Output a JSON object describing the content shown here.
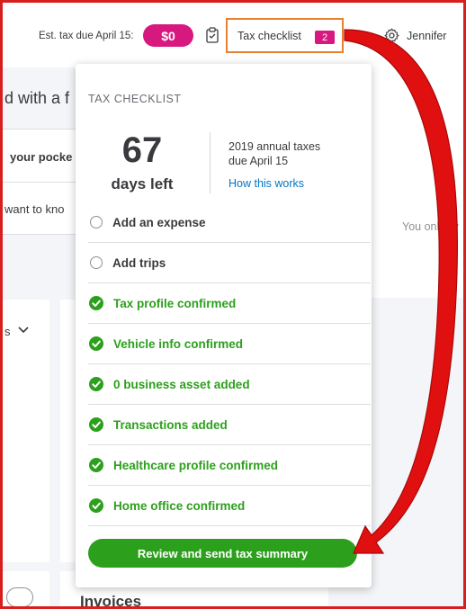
{
  "header": {
    "est_tax_label": "Est. tax due April 15:",
    "est_tax_value": "$0",
    "checklist_label": "Tax checklist",
    "checklist_count": "2",
    "user_name": "Jennifer"
  },
  "background": {
    "heading_fragment": "d with a f",
    "card_title_fragment": "your pocke",
    "card_text_fragment": "want to kno",
    "side_fragment": "s",
    "right_text_fragment": "You only liv",
    "invoices_label": "Invoices"
  },
  "checklist": {
    "title": "TAX CHECKLIST",
    "days_number": "67",
    "days_label": "days left",
    "annual_line1": "2019 annual taxes",
    "annual_line2": "due April 15",
    "how_link": "How this works",
    "items": [
      {
        "label": "Add an expense",
        "done": false
      },
      {
        "label": "Add trips",
        "done": false
      },
      {
        "label": "Tax profile confirmed",
        "done": true
      },
      {
        "label": "Vehicle info confirmed",
        "done": true
      },
      {
        "label": "0 business asset added",
        "done": true
      },
      {
        "label": "Transactions added",
        "done": true
      },
      {
        "label": "Healthcare profile confirmed",
        "done": true
      },
      {
        "label": "Home office confirmed",
        "done": true
      }
    ],
    "review_button": "Review and send tax summary"
  },
  "colors": {
    "accent_magenta": "#d6187f",
    "success_green": "#2ca01c",
    "link_blue": "#0077c5",
    "highlight_orange": "#e98030",
    "annotation_red": "#d71f1f"
  }
}
